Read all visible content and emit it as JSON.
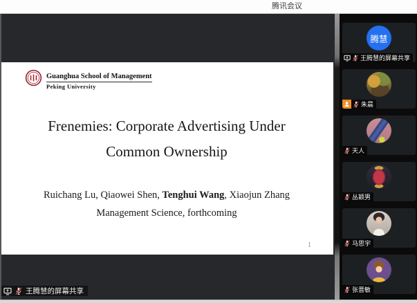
{
  "window": {
    "title": "腾讯会议"
  },
  "main_view": {
    "share_label": "王腾慧的屏幕共享",
    "slide": {
      "logo_line1": "Guanghua School of Management",
      "logo_line2": "Peking University",
      "title_line1": "Frenemies: Corporate Advertising Under",
      "title_line2": "Common Ownership",
      "authors_pre": "Ruichang Lu, Qiaowei Shen, ",
      "authors_bold": "Tenghui Wang",
      "authors_post": ", Xiaojun Zhang",
      "venue": "Management Science, forthcoming",
      "page_number": "1"
    }
  },
  "sidebar": {
    "participants": [
      {
        "name": "王腾慧的屏幕共享",
        "avatar_text": "腾慧",
        "muted": true,
        "screen_share": true
      },
      {
        "name": "朱晨",
        "muted": true,
        "member_badge": true
      },
      {
        "name": "天人",
        "muted": true
      },
      {
        "name": "丛颖男",
        "muted": true
      },
      {
        "name": "马思宇",
        "muted": true
      },
      {
        "name": "张晋敏",
        "muted": true
      }
    ]
  },
  "colors": {
    "avatar_blue": "#2470f0",
    "mic_muted_red": "#e33b30",
    "member_badge_orange": "#ef8f2c",
    "main_bg": "#26282b",
    "tile_bg": "#1d2023",
    "slide_bg": "#ffffff"
  }
}
